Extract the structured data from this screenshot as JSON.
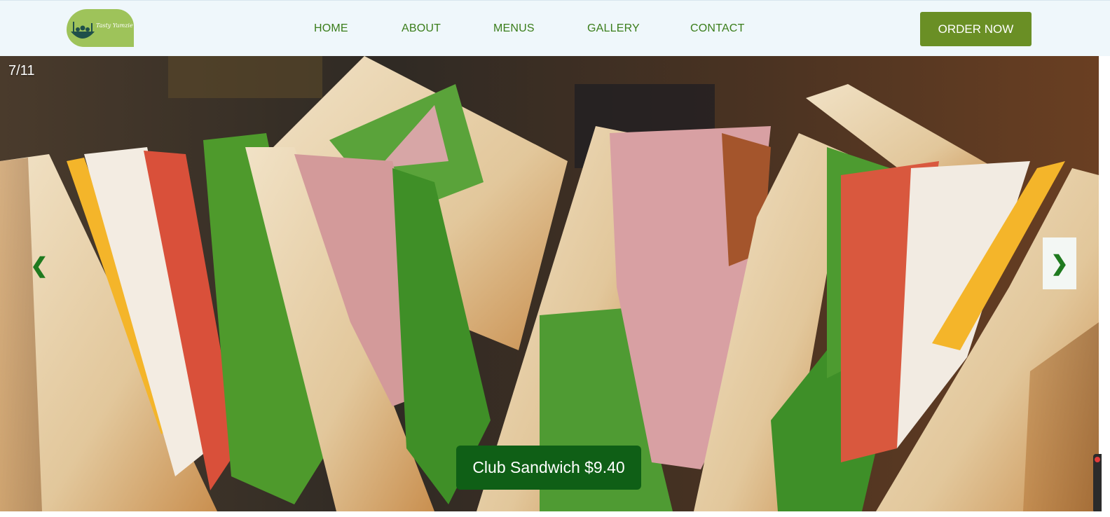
{
  "header": {
    "logo_text": "Tasty Yumzie",
    "nav": [
      "HOME",
      "ABOUT",
      "MENUS",
      "GALLERY",
      "CONTACT"
    ],
    "order_button": "ORDER NOW"
  },
  "slideshow": {
    "counter": "7/11",
    "prev_glyph": "❮",
    "next_glyph": "❯",
    "caption": "Club Sandwich $9.40"
  },
  "colors": {
    "header_bg": "#eff7fb",
    "nav_text": "#3a7d1a",
    "order_button_bg": "#6a8f25",
    "caption_bg": "#0f5f16",
    "arrow": "#1f7a1f"
  },
  "icons": {
    "logo": "food-bowl-icon",
    "prev": "chevron-left-icon",
    "next": "chevron-right-icon"
  }
}
